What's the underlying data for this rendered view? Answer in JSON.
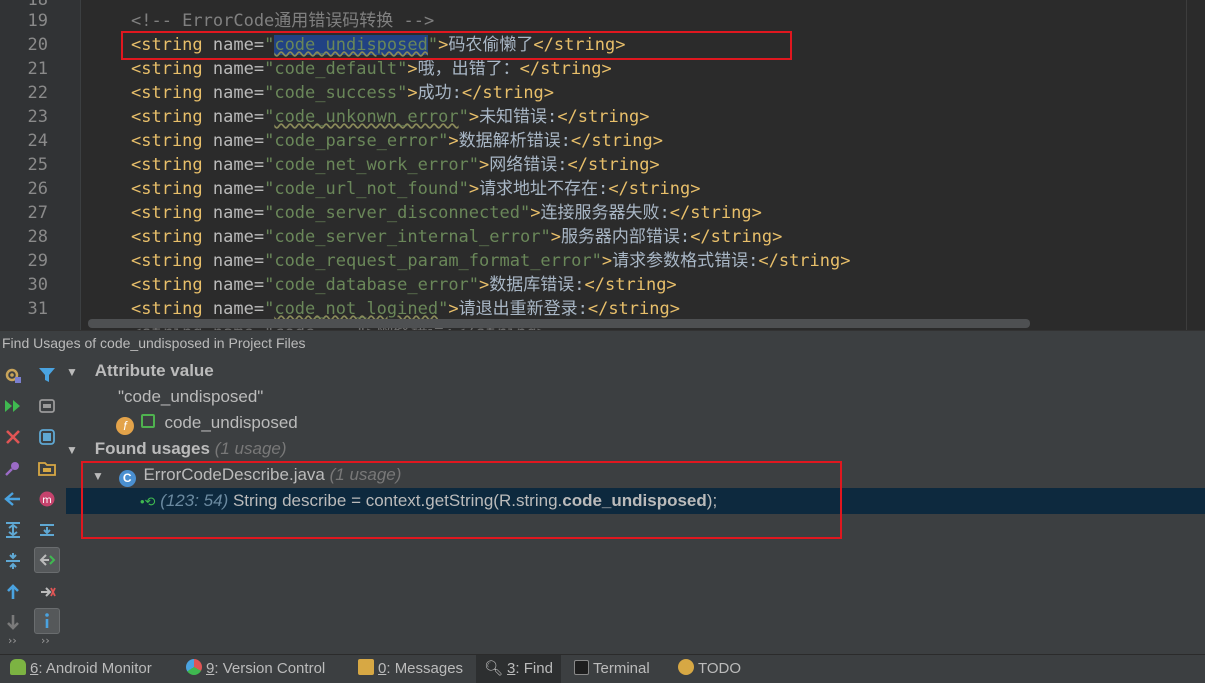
{
  "editor": {
    "line_numbers": [
      "18",
      "19",
      "20",
      "21",
      "22",
      "23",
      "24",
      "25",
      "26",
      "27",
      "28",
      "29",
      "30",
      "31"
    ],
    "comment": "<!-- ErrorCode通用错误码转换 -->",
    "lines": [
      {
        "name": "code_undisposed",
        "text": "码农偷懒了"
      },
      {
        "name": "code_default",
        "text": "哦，出错了："
      },
      {
        "name": "code_success",
        "text": "成功:"
      },
      {
        "name": "code_unkonwn_error",
        "text": "未知错误:"
      },
      {
        "name": "code_parse_error",
        "text": "数据解析错误:"
      },
      {
        "name": "code_net_work_error",
        "text": "网络错误:"
      },
      {
        "name": "code_url_not_found",
        "text": "请求地址不存在:"
      },
      {
        "name": "code_server_disconnected",
        "text": "连接服务器失败:"
      },
      {
        "name": "code_server_internal_error",
        "text": "服务器内部错误:"
      },
      {
        "name": "code_request_param_format_error",
        "text": "请求参数格式错误:"
      },
      {
        "name": "code_database_error",
        "text": "数据库错误:"
      },
      {
        "name": "code_not_logined",
        "text": "请退出重新登录:"
      }
    ],
    "partial_line": "<string name=\"code_...\">网络错误:</string>"
  },
  "find": {
    "header": "Find Usages of code_undisposed in Project Files",
    "attribute_value_label": "Attribute value",
    "attribute_quoted": "\"code_undisposed\"",
    "field_name": "code_undisposed",
    "found_usages_label": "Found usages",
    "found_usages_count": "(1 usage)",
    "file_name": "ErrorCodeDescribe.java",
    "file_count": "(1 usage)",
    "usage_location": "(123: 54)",
    "usage_code_prefix": " String describe = context.getString(R.string.",
    "usage_code_bold": "code_undisposed",
    "usage_code_suffix": ");"
  },
  "toolbar_icons": {
    "left_column": [
      "settings-icon",
      "rerun-icon",
      "close-icon",
      "pin-icon",
      "previous-occurrence-icon",
      "expand-all-icon",
      "collapse-all-icon",
      "up-icon",
      "down-icon"
    ],
    "right_column": [
      "filter-icon",
      "group-by-module-icon",
      "group-by-package-icon",
      "group-by-directory-icon",
      "merge-usages-icon",
      "expand-icon",
      "navigate-icon",
      "autoscroll-icon",
      "info-icon"
    ]
  },
  "bottom_tabs": [
    {
      "key": "6",
      "label": "Android Monitor"
    },
    {
      "key": "9",
      "label": "Version Control"
    },
    {
      "key": "0",
      "label": "Messages"
    },
    {
      "key": "3",
      "label": "Find"
    },
    {
      "key": "",
      "label": "Terminal"
    },
    {
      "key": "",
      "label": "TODO"
    }
  ],
  "colors": {
    "editor_bg": "#2b2b2b",
    "tag": "#e8bf6a",
    "string_value": "#6a8759",
    "selection": "#214283",
    "highlight_box": "#e0171f"
  }
}
